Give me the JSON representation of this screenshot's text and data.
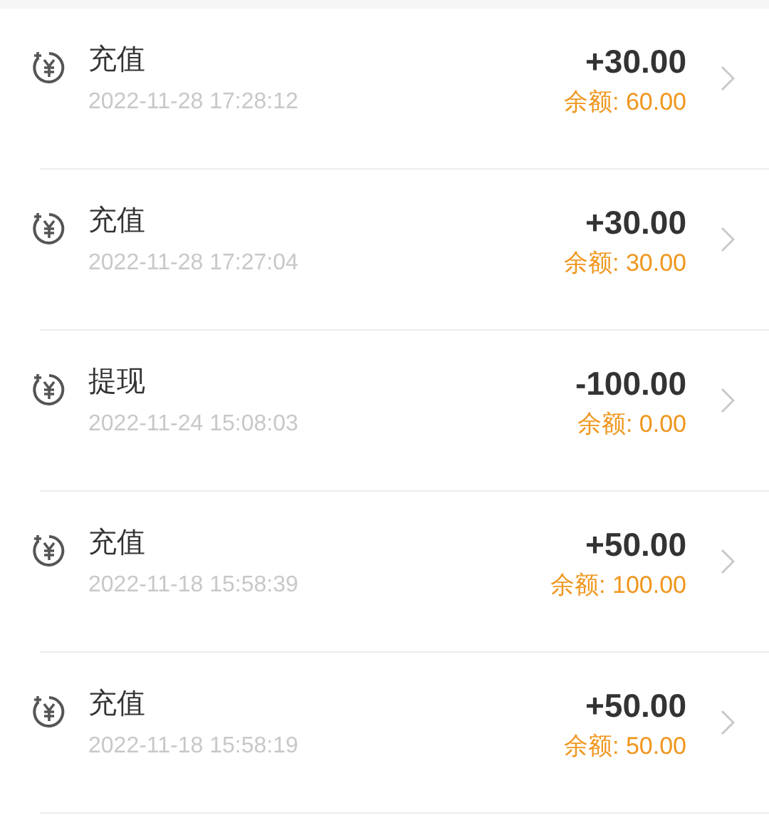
{
  "transactions": [
    {
      "type": "充值",
      "time": "2022-11-28 17:28:12",
      "amount": "+30.00",
      "balance": "余额: 60.00"
    },
    {
      "type": "充值",
      "time": "2022-11-28 17:27:04",
      "amount": "+30.00",
      "balance": "余额: 30.00"
    },
    {
      "type": "提现",
      "time": "2022-11-24 15:08:03",
      "amount": "-100.00",
      "balance": "余额: 0.00"
    },
    {
      "type": "充值",
      "time": "2022-11-18 15:58:39",
      "amount": "+50.00",
      "balance": "余额: 100.00"
    },
    {
      "type": "充值",
      "time": "2022-11-18 15:58:19",
      "amount": "+50.00",
      "balance": "余额: 50.00"
    }
  ]
}
